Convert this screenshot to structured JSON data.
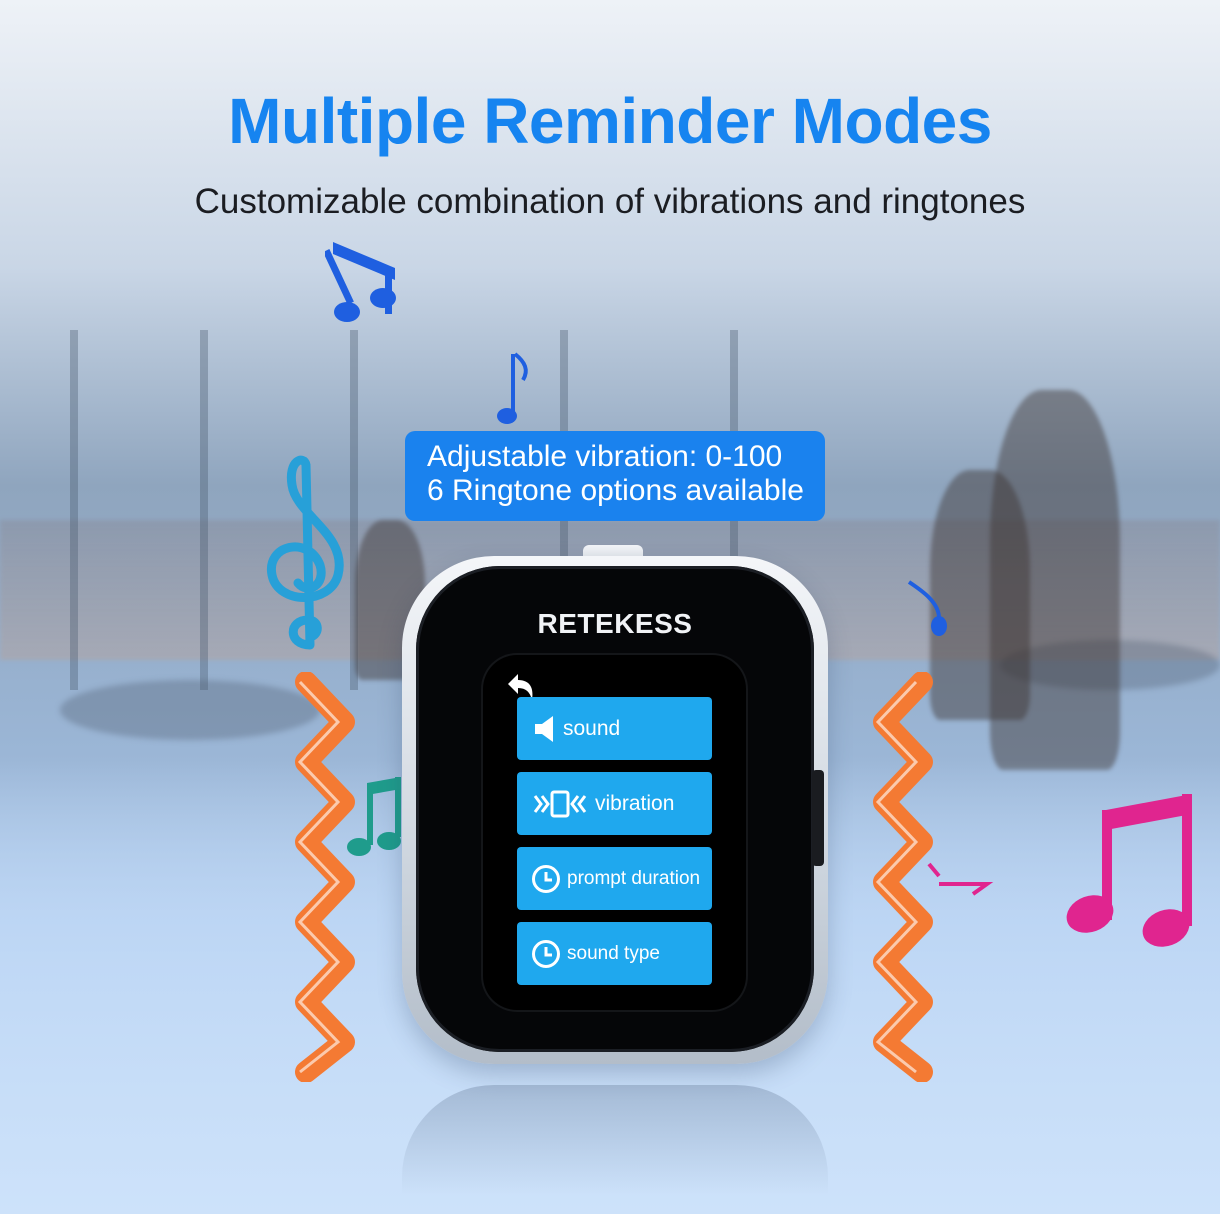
{
  "headline": {
    "title": "Multiple Reminder Modes",
    "subtitle": "Customizable combination of vibrations and ringtones"
  },
  "callout": {
    "line1": "Adjustable vibration: 0-100",
    "line2": "6 Ringtone options available"
  },
  "device": {
    "brand": "RETEKESS",
    "menu": [
      {
        "label": "sound",
        "icon": "speaker-icon"
      },
      {
        "label": "vibration",
        "icon": "vibration-icon"
      },
      {
        "label": "prompt duration",
        "icon": "clock-icon"
      },
      {
        "label": "sound type",
        "icon": "clock-icon"
      }
    ],
    "back_icon": "back-arrow-icon"
  },
  "colors": {
    "title_blue": "#1684f0",
    "callout_blue": "#1a82ee",
    "menu_button": "#1fa8ee",
    "zigzag_orange": "#f47a33",
    "note_blue": "#1f5fe0",
    "note_magenta": "#e0258f",
    "note_teal": "#1f9c8c"
  }
}
